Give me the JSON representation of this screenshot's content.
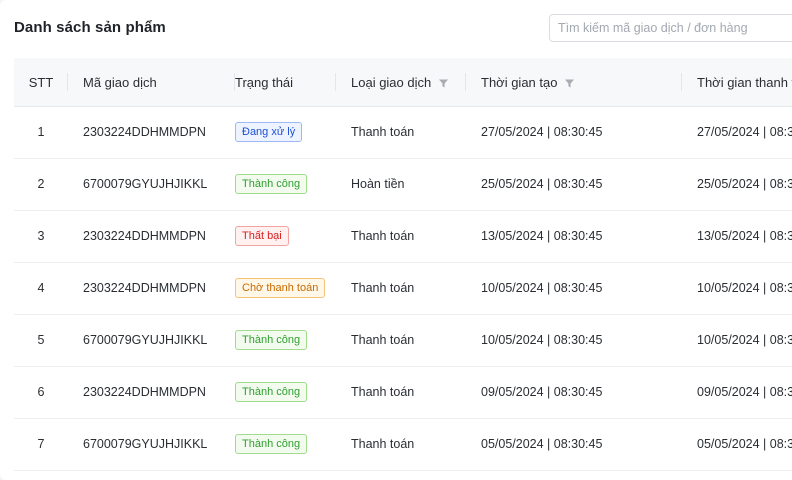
{
  "page": {
    "title": "Danh sách sản phẩm"
  },
  "search": {
    "placeholder": "Tìm kiếm mã giao dịch / đơn hàng"
  },
  "table": {
    "columns": {
      "stt": "STT",
      "code": "Mã giao dịch",
      "status": "Trạng thái",
      "type": "Loại giao dịch",
      "created": "Thời gian tạo",
      "updated": "Thời gian thanh t"
    },
    "rows": [
      {
        "stt": "1",
        "code": "2303224DDHMMDPN",
        "status": "Đang xử lý",
        "status_kind": "processing",
        "type": "Thanh toán",
        "created": "27/05/2024 | 08:30:45",
        "updated": "27/05/2024 | 08:3"
      },
      {
        "stt": "2",
        "code": "6700079GYUJHJIKKL",
        "status": "Thành công",
        "status_kind": "success",
        "type": "Hoàn tiền",
        "created": "25/05/2024 | 08:30:45",
        "updated": "25/05/2024 | 08:3"
      },
      {
        "stt": "3",
        "code": "2303224DDHMMDPN",
        "status": "Thất bại",
        "status_kind": "failed",
        "type": "Thanh toán",
        "created": "13/05/2024 | 08:30:45",
        "updated": "13/05/2024 | 08:3"
      },
      {
        "stt": "4",
        "code": "2303224DDHMMDPN",
        "status": "Chờ thanh toán",
        "status_kind": "pending",
        "type": "Thanh toán",
        "created": "10/05/2024 | 08:30:45",
        "updated": "10/05/2024 | 08:3"
      },
      {
        "stt": "5",
        "code": "6700079GYUJHJIKKL",
        "status": "Thành công",
        "status_kind": "success",
        "type": "Thanh toán",
        "created": "10/05/2024 | 08:30:45",
        "updated": "10/05/2024 | 08:3"
      },
      {
        "stt": "6",
        "code": "2303224DDHMMDPN",
        "status": "Thành công",
        "status_kind": "success",
        "type": "Thanh toán",
        "created": "09/05/2024 | 08:30:45",
        "updated": "09/05/2024 | 08:3"
      },
      {
        "stt": "7",
        "code": "6700079GYUJHJIKKL",
        "status": "Thành công",
        "status_kind": "success",
        "type": "Thanh toán",
        "created": "05/05/2024 | 08:30:45",
        "updated": "05/05/2024 | 08:3"
      }
    ]
  },
  "icons": {
    "filter_type": "filter-icon",
    "filter_created": "filter-icon"
  },
  "colors": {
    "processing": "#1d4ed8",
    "success": "#2f9e2f",
    "failed": "#d92020",
    "pending": "#c96a00"
  }
}
